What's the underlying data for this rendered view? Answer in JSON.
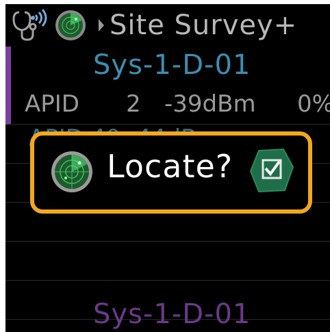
{
  "header": {
    "title": "Site Survey+",
    "icons": [
      "stethoscope-wireless-icon",
      "radar-icon",
      "chevron-right-icon"
    ]
  },
  "list": {
    "rows": [
      {
        "name": "Sys-1-D-01",
        "fields": {
          "type": "APID",
          "channel": "2",
          "signal": "-39dBm",
          "percent": "0%"
        }
      },
      {
        "partial_text": "APID   40   -44dBm"
      }
    ]
  },
  "footer": {
    "name": "Sys-1-D-01"
  },
  "dialog": {
    "message": "Locate?",
    "confirm_icon": "checkbox-checked-icon"
  },
  "colors": {
    "accent_border": "#f2a81c",
    "selected_bar": "#7b3fa0",
    "row_name": "#3a8fb0",
    "footer_name": "#6a3a8a",
    "radar_green": "#2fae4f"
  }
}
